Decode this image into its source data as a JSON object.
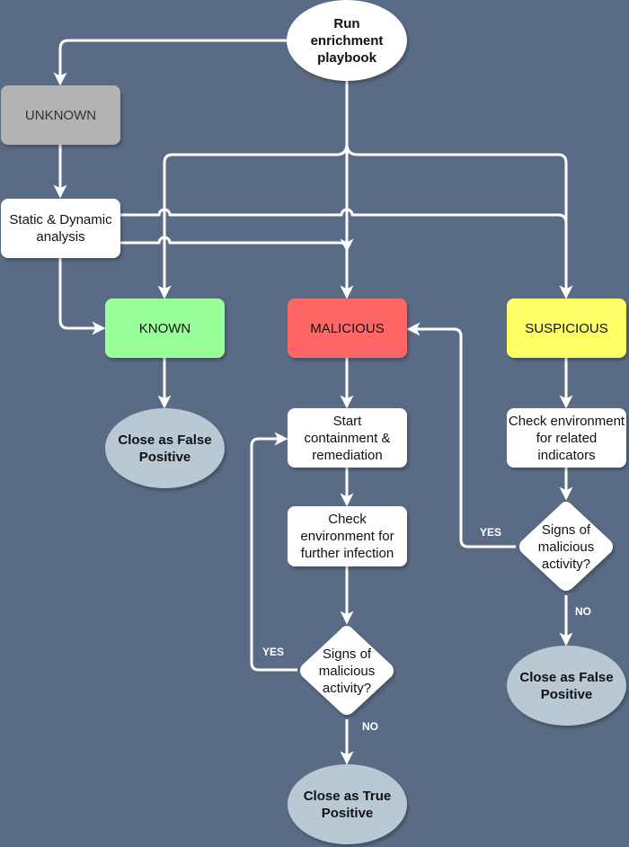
{
  "colors": {
    "background": "#5a6c85",
    "unknown": "#b3b3b3",
    "known": "#99ff99",
    "malicious": "#ff6666",
    "suspicious": "#ffff66",
    "terminal": "#bac8d3",
    "process": "#ffffff",
    "edge": "#ffffff"
  },
  "nodes": {
    "start": "Run enrichment playbook",
    "unknown": "UNKNOWN",
    "analysis": "Static & Dynamic analysis",
    "known": "KNOWN",
    "malicious": "MALICIOUS",
    "suspicious": "SUSPICIOUS",
    "known_close": "Close as False Positive",
    "containment": "Start containment & remediation",
    "check_further": "Check environment for further infection",
    "decision_malicious": "Signs of malicious activity?",
    "close_true": "Close as True Positive",
    "check_related": "Check environment for related indicators",
    "decision_suspicious": "Signs of malicious activity?",
    "suspicious_close": "Close as False Positive"
  },
  "edge_labels": {
    "malicious_yes": "YES",
    "malicious_no": "NO",
    "suspicious_yes": "YES",
    "suspicious_no": "NO"
  }
}
